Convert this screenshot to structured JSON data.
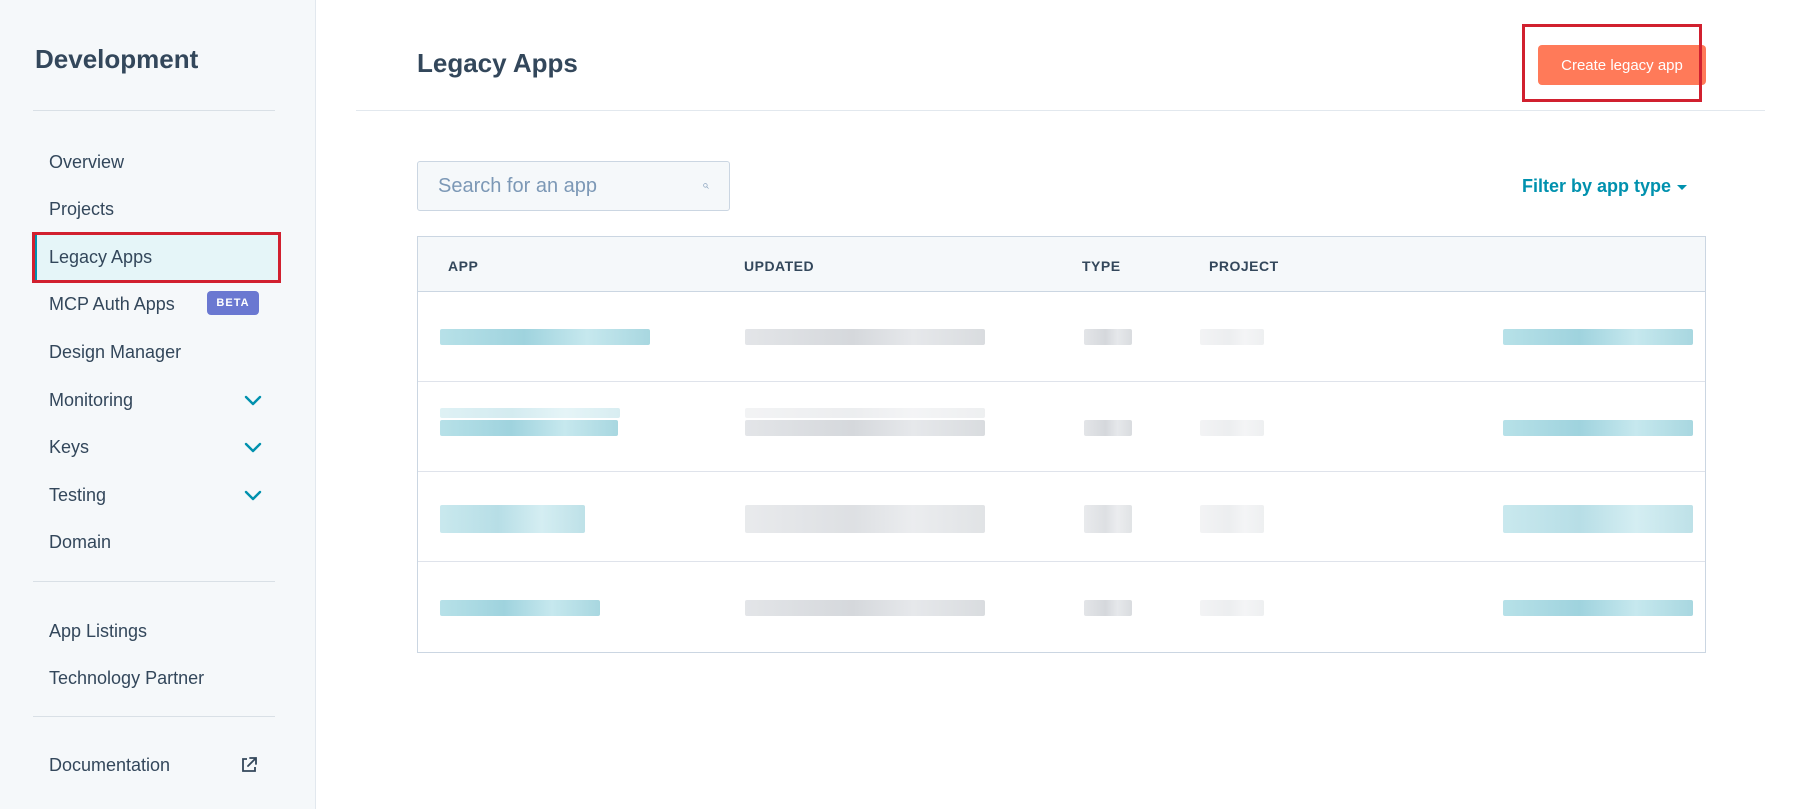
{
  "sidebar": {
    "title": "Development",
    "items": [
      {
        "label": "Overview"
      },
      {
        "label": "Projects"
      },
      {
        "label": "Legacy Apps"
      },
      {
        "label": "MCP Auth Apps",
        "badge": "BETA"
      },
      {
        "label": "Design Manager"
      },
      {
        "label": "Monitoring"
      },
      {
        "label": "Keys"
      },
      {
        "label": "Testing"
      },
      {
        "label": "Domain"
      },
      {
        "label": "App Listings"
      },
      {
        "label": "Technology Partner"
      },
      {
        "label": "Documentation"
      }
    ]
  },
  "header": {
    "title": "Legacy Apps",
    "create_button": "Create legacy app"
  },
  "search": {
    "placeholder": "Search for an app"
  },
  "filter": {
    "label": "Filter by app type"
  },
  "table": {
    "columns": [
      "APP",
      "UPDATED",
      "TYPE",
      "PROJECT"
    ]
  },
  "colors": {
    "accent": "#0091ae",
    "primary_button": "#ff7a59",
    "beta_badge": "#6a78d1",
    "highlight_box": "#d1202f"
  },
  "icons": {
    "search": "search-icon",
    "expand": "chevron-down-icon",
    "external": "external-link-icon"
  }
}
